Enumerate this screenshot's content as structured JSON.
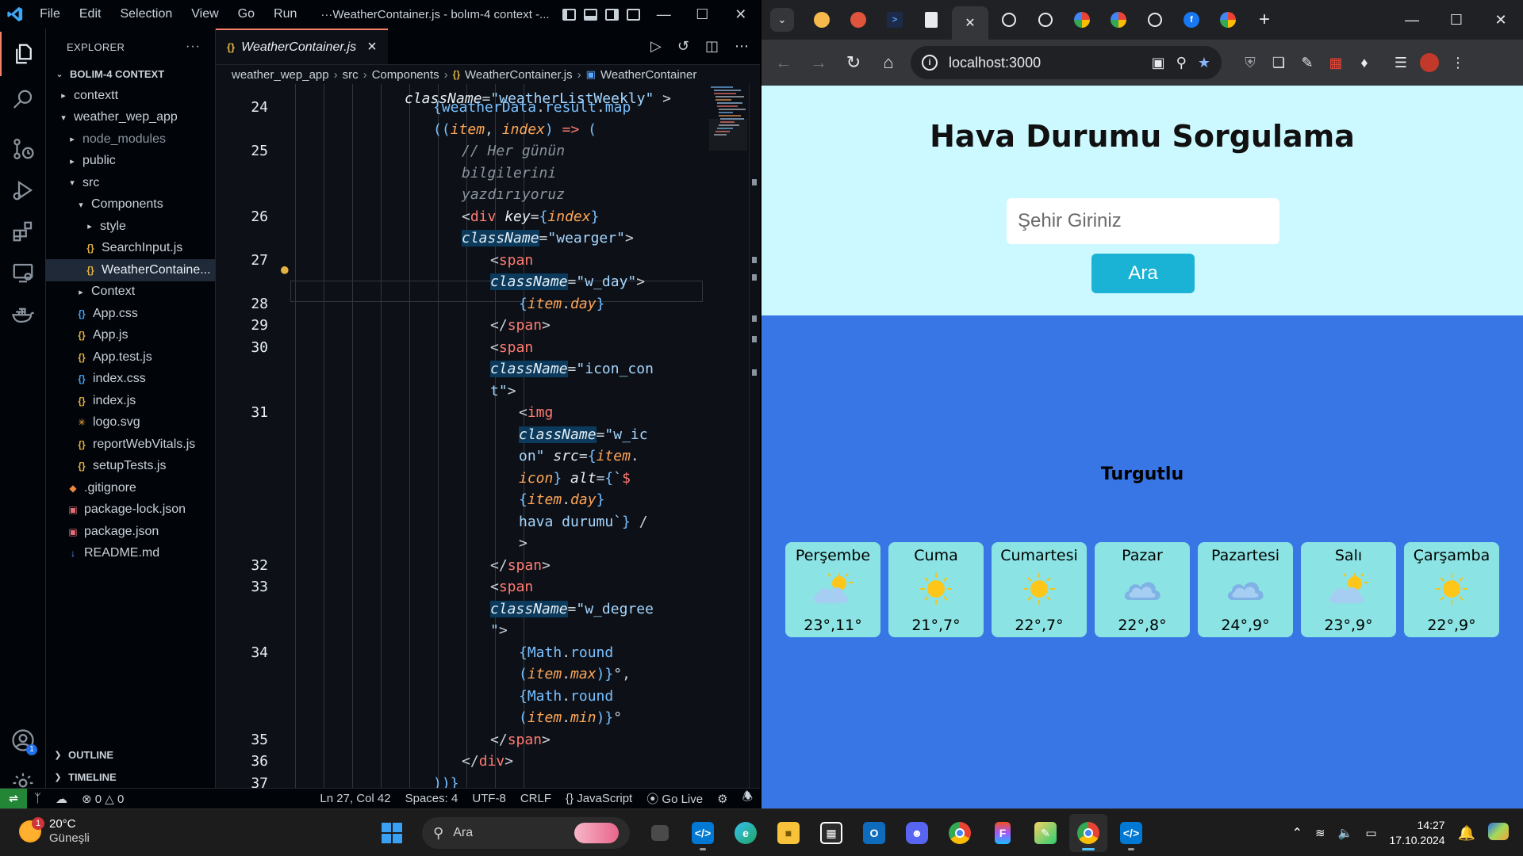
{
  "vscode": {
    "menu": [
      "File",
      "Edit",
      "Selection",
      "View",
      "Go",
      "Run"
    ],
    "command_center": "···WeatherContainer.js - bolım-4 context -...",
    "explorer_title": "EXPLORER",
    "explorer_more": "···",
    "workspace": "BOLIM-4 CONTEXT",
    "tree": [
      {
        "label": "contextt",
        "kind": "folder",
        "indent": 1,
        "open": false
      },
      {
        "label": "weather_wep_app",
        "kind": "folder",
        "indent": 1,
        "open": true
      },
      {
        "label": "node_modules",
        "kind": "folder",
        "indent": 2,
        "open": false,
        "dim": true
      },
      {
        "label": "public",
        "kind": "folder",
        "indent": 2,
        "open": false
      },
      {
        "label": "src",
        "kind": "folder",
        "indent": 2,
        "open": true
      },
      {
        "label": "Components",
        "kind": "folder",
        "indent": 3,
        "open": true
      },
      {
        "label": "style",
        "kind": "folder",
        "indent": 4,
        "open": false
      },
      {
        "label": "SearchInput.js",
        "kind": "js",
        "indent": 4
      },
      {
        "label": "WeatherContaine...",
        "kind": "js",
        "indent": 4,
        "selected": true
      },
      {
        "label": "Context",
        "kind": "folder",
        "indent": 3,
        "open": false
      },
      {
        "label": "App.css",
        "kind": "css",
        "indent": 3
      },
      {
        "label": "App.js",
        "kind": "js",
        "indent": 3
      },
      {
        "label": "App.test.js",
        "kind": "js",
        "indent": 3
      },
      {
        "label": "index.css",
        "kind": "css",
        "indent": 3
      },
      {
        "label": "index.js",
        "kind": "js",
        "indent": 3
      },
      {
        "label": "logo.svg",
        "kind": "svg",
        "indent": 3
      },
      {
        "label": "reportWebVitals.js",
        "kind": "js",
        "indent": 3
      },
      {
        "label": "setupTests.js",
        "kind": "js",
        "indent": 3
      },
      {
        "label": ".gitignore",
        "kind": "git",
        "indent": 2
      },
      {
        "label": "package-lock.json",
        "kind": "json",
        "indent": 2
      },
      {
        "label": "package.json",
        "kind": "json",
        "indent": 2
      },
      {
        "label": "README.md",
        "kind": "md",
        "indent": 2
      }
    ],
    "outline": "OUTLINE",
    "timeline": "TIMELINE",
    "tab": {
      "icon": "{}",
      "label": "WeatherContainer.js",
      "close": "×"
    },
    "breadcrumb": [
      "weather_wep_app",
      "src",
      "Components",
      "WeatherContainer.js",
      "WeatherContainer"
    ],
    "code": [
      {
        "ln": "",
        "row": -0.4,
        "indent": 4,
        "tokens": [
          [
            "attr2",
            "className"
          ],
          [
            "pl",
            "="
          ],
          [
            "str",
            "\"weatherListWeekly\""
          ],
          [
            "pl",
            " >"
          ]
        ]
      },
      {
        "ln": "24",
        "row": 0,
        "indent": 5,
        "tokens": [
          [
            "brace",
            "{"
          ],
          [
            "obj",
            "weatherData"
          ],
          [
            "pl",
            "."
          ],
          [
            "fn",
            "result"
          ],
          [
            "pl",
            "."
          ],
          [
            "fn",
            "map"
          ]
        ]
      },
      {
        "ln": "",
        "row": 1,
        "indent": 5,
        "tokens": [
          [
            "brace",
            "(("
          ],
          [
            "var",
            "item"
          ],
          [
            "pl",
            ", "
          ],
          [
            "var",
            "index"
          ],
          [
            "brace",
            ")"
          ],
          [
            "op",
            " => "
          ],
          [
            "brace",
            "("
          ]
        ]
      },
      {
        "ln": "25",
        "row": 2,
        "indent": 6,
        "tokens": [
          [
            "cm",
            "// Her günün"
          ]
        ]
      },
      {
        "ln": "",
        "row": 3,
        "indent": 6,
        "tokens": [
          [
            "cm",
            "bilgilerini"
          ]
        ]
      },
      {
        "ln": "",
        "row": 4,
        "indent": 6,
        "tokens": [
          [
            "cm",
            "yazdırıyoruz"
          ]
        ]
      },
      {
        "ln": "26",
        "row": 5,
        "indent": 6,
        "tokens": [
          [
            "pl",
            "<"
          ],
          [
            "tag",
            "div"
          ],
          [
            "pl",
            " "
          ],
          [
            "attr2",
            "key"
          ],
          [
            "pl",
            "="
          ],
          [
            "brace",
            "{"
          ],
          [
            "var",
            "index"
          ],
          [
            "brace",
            "}"
          ]
        ]
      },
      {
        "ln": "",
        "row": 6,
        "indent": 6,
        "tokens": [
          [
            "attr",
            "className"
          ],
          [
            "pl",
            "="
          ],
          [
            "str",
            "\"wearger\""
          ],
          [
            "pl",
            ">"
          ]
        ]
      },
      {
        "ln": "27",
        "row": 7,
        "indent": 7,
        "tokens": [
          [
            "pl",
            "<"
          ],
          [
            "tag",
            "span"
          ]
        ]
      },
      {
        "ln": "",
        "row": 8,
        "indent": 7,
        "tokens": [
          [
            "attr",
            "className"
          ],
          [
            "pl",
            "="
          ],
          [
            "str",
            "\"w_day\""
          ],
          [
            "pl",
            ">"
          ]
        ]
      },
      {
        "ln": "28",
        "row": 9,
        "indent": 8,
        "tokens": [
          [
            "brace",
            "{"
          ],
          [
            "var",
            "item"
          ],
          [
            "pl",
            "."
          ],
          [
            "prop",
            "day"
          ],
          [
            "brace",
            "}"
          ]
        ]
      },
      {
        "ln": "29",
        "row": 10,
        "indent": 7,
        "tokens": [
          [
            "pl",
            "</"
          ],
          [
            "tag",
            "span"
          ],
          [
            "pl",
            ">"
          ]
        ]
      },
      {
        "ln": "30",
        "row": 11,
        "indent": 7,
        "tokens": [
          [
            "pl",
            "<"
          ],
          [
            "tag",
            "span"
          ]
        ]
      },
      {
        "ln": "",
        "row": 12,
        "indent": 7,
        "tokens": [
          [
            "attr",
            "className"
          ],
          [
            "pl",
            "="
          ],
          [
            "str",
            "\"icon_con"
          ]
        ]
      },
      {
        "ln": "",
        "row": 13,
        "indent": 7,
        "tokens": [
          [
            "str",
            "t\""
          ],
          [
            "pl",
            ">"
          ]
        ]
      },
      {
        "ln": "31",
        "row": 14,
        "indent": 8,
        "tokens": [
          [
            "pl",
            "<"
          ],
          [
            "tag",
            "img"
          ]
        ]
      },
      {
        "ln": "",
        "row": 15,
        "indent": 8,
        "tokens": [
          [
            "attr",
            "className"
          ],
          [
            "pl",
            "="
          ],
          [
            "str",
            "\"w_ic"
          ]
        ]
      },
      {
        "ln": "",
        "row": 16,
        "indent": 8,
        "tokens": [
          [
            "str",
            "on\""
          ],
          [
            "pl",
            " "
          ],
          [
            "attr2",
            "src"
          ],
          [
            "pl",
            "="
          ],
          [
            "brace",
            "{"
          ],
          [
            "var",
            "item"
          ],
          [
            "pl",
            "."
          ]
        ]
      },
      {
        "ln": "",
        "row": 17,
        "indent": 8,
        "tokens": [
          [
            "prop",
            "icon"
          ],
          [
            "brace",
            "}"
          ],
          [
            "pl",
            " "
          ],
          [
            "attr2",
            "alt"
          ],
          [
            "pl",
            "="
          ],
          [
            "brace",
            "{"
          ],
          [
            "str",
            "`"
          ],
          [
            "op",
            "$"
          ]
        ]
      },
      {
        "ln": "",
        "row": 18,
        "indent": 8,
        "tokens": [
          [
            "brace",
            "{"
          ],
          [
            "var",
            "item"
          ],
          [
            "pl",
            "."
          ],
          [
            "prop",
            "day"
          ],
          [
            "brace",
            "}"
          ]
        ]
      },
      {
        "ln": "",
        "row": 19,
        "indent": 8,
        "tokens": [
          [
            "str",
            "hava durumu`"
          ],
          [
            "brace",
            "}"
          ],
          [
            "pl",
            " /"
          ]
        ]
      },
      {
        "ln": "",
        "row": 20,
        "indent": 8,
        "tokens": [
          [
            "pl",
            ">"
          ]
        ]
      },
      {
        "ln": "32",
        "row": 21,
        "indent": 7,
        "tokens": [
          [
            "pl",
            "</"
          ],
          [
            "tag",
            "span"
          ],
          [
            "pl",
            ">"
          ]
        ]
      },
      {
        "ln": "33",
        "row": 22,
        "indent": 7,
        "tokens": [
          [
            "pl",
            "<"
          ],
          [
            "tag",
            "span"
          ]
        ]
      },
      {
        "ln": "",
        "row": 23,
        "indent": 7,
        "tokens": [
          [
            "attr",
            "className"
          ],
          [
            "pl",
            "="
          ],
          [
            "str",
            "\"w_degree"
          ]
        ]
      },
      {
        "ln": "",
        "row": 24,
        "indent": 7,
        "tokens": [
          [
            "str",
            "\""
          ],
          [
            "pl",
            ">"
          ]
        ]
      },
      {
        "ln": "34",
        "row": 25,
        "indent": 8,
        "tokens": [
          [
            "brace",
            "{"
          ],
          [
            "obj",
            "Math"
          ],
          [
            "pl",
            "."
          ],
          [
            "fn",
            "round"
          ]
        ]
      },
      {
        "ln": "",
        "row": 26,
        "indent": 8,
        "tokens": [
          [
            "brace",
            "("
          ],
          [
            "var",
            "item"
          ],
          [
            "pl",
            "."
          ],
          [
            "prop",
            "max"
          ],
          [
            "brace",
            ")}"
          ],
          [
            "pl",
            "°,"
          ]
        ]
      },
      {
        "ln": "",
        "row": 27,
        "indent": 8,
        "tokens": [
          [
            "brace",
            "{"
          ],
          [
            "obj",
            "Math"
          ],
          [
            "pl",
            "."
          ],
          [
            "fn",
            "round"
          ]
        ]
      },
      {
        "ln": "",
        "row": 28,
        "indent": 8,
        "tokens": [
          [
            "brace",
            "("
          ],
          [
            "var",
            "item"
          ],
          [
            "pl",
            "."
          ],
          [
            "prop",
            "min"
          ],
          [
            "brace",
            ")}"
          ],
          [
            "pl",
            "°"
          ]
        ]
      },
      {
        "ln": "35",
        "row": 29,
        "indent": 7,
        "tokens": [
          [
            "pl",
            "</"
          ],
          [
            "tag",
            "span"
          ],
          [
            "pl",
            ">"
          ]
        ]
      },
      {
        "ln": "36",
        "row": 30,
        "indent": 6,
        "tokens": [
          [
            "pl",
            "</"
          ],
          [
            "tag",
            "div"
          ],
          [
            "pl",
            ">"
          ]
        ]
      },
      {
        "ln": "37",
        "row": 31,
        "indent": 5,
        "tokens": [
          [
            "brace",
            ")"
          ],
          [
            "brace",
            ")}"
          ]
        ]
      }
    ],
    "status": {
      "errors": "0",
      "warnings": "0",
      "position": "Ln 27, Col 42",
      "spaces": "Spaces: 4",
      "encoding": "UTF-8",
      "eol": "CRLF",
      "language": "JavaScript",
      "golive": "Go Live"
    },
    "accounts_badge": "1"
  },
  "chrome": {
    "url": "localhost:3000",
    "tabs": [
      {
        "icon": "orange-circle-icon",
        "color": "#f6b94b"
      },
      {
        "icon": "red-hat-icon",
        "color": "#e0533d"
      },
      {
        "icon": "terminal-icon",
        "color": "#1f6feb"
      },
      {
        "icon": "blank-page-icon",
        "color": "#e8eaed"
      },
      {
        "icon": "close-icon",
        "color": "#e8eaed",
        "active": true
      },
      {
        "icon": "triangle-logo-icon",
        "color": "#e8eaed"
      },
      {
        "icon": "openai-icon",
        "color": "#e8eaed"
      },
      {
        "icon": "google-icon",
        "color": "#4285f4"
      },
      {
        "icon": "google-icon",
        "color": "#4285f4"
      },
      {
        "icon": "speaker-icon",
        "color": "#e8eaed"
      },
      {
        "icon": "facebook-icon",
        "color": "#1877f2"
      },
      {
        "icon": "google-icon",
        "color": "#4285f4"
      }
    ]
  },
  "app": {
    "title": "Hava Durumu Sorgulama",
    "input_placeholder": "Şehir Giriniz",
    "button_label": "Ara",
    "city": "Turgutlu",
    "days": [
      {
        "day": "Perşembe",
        "temp": "23°,11°",
        "icon": "partly-cloudy-icon"
      },
      {
        "day": "Cuma",
        "temp": "21°,7°",
        "icon": "sun-icon"
      },
      {
        "day": "Cumartesi",
        "temp": "22°,7°",
        "icon": "sun-icon"
      },
      {
        "day": "Pazar",
        "temp": "22°,8°",
        "icon": "cloud-icon"
      },
      {
        "day": "Pazartesi",
        "temp": "24°,9°",
        "icon": "cloud-icon"
      },
      {
        "day": "Salı",
        "temp": "23°,9°",
        "icon": "partly-cloudy-icon"
      },
      {
        "day": "Çarşamba",
        "temp": "22°,9°",
        "icon": "sun-icon"
      }
    ],
    "colors": {
      "hero": "#ccf9ff",
      "background": "#3776e4",
      "card": "#8be3e3",
      "button": "#1ab3d6"
    }
  },
  "taskbar": {
    "weather_temp": "20°C",
    "weather_desc": "Güneşli",
    "weather_badge": "1",
    "search_label": "Ara",
    "time": "14:27",
    "date": "17.10.2024"
  }
}
